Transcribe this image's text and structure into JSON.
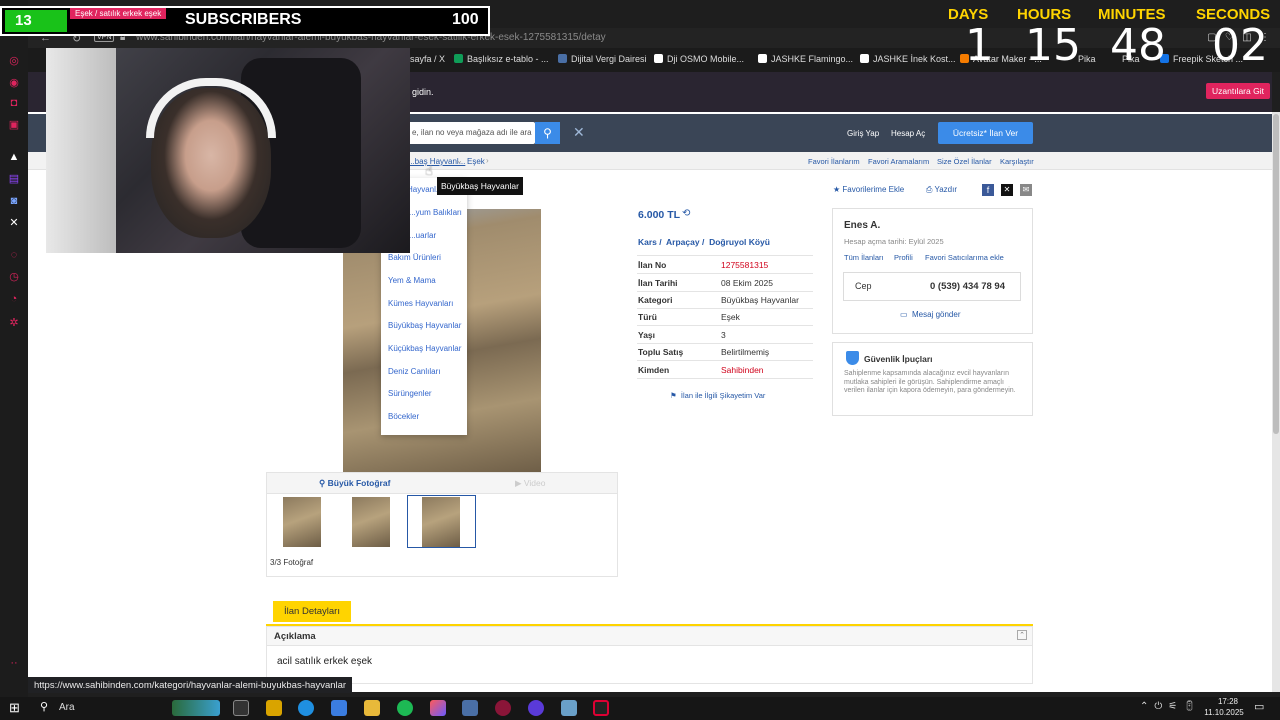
{
  "stream": {
    "sub_count_left": "13",
    "ticker_text": "Eşek / satılık erkek eşek",
    "subscribers_label": "SUBSCRIBERS",
    "subscribers_value": "100",
    "timer": {
      "days_label": "DAYS",
      "hours_label": "HOURS",
      "minutes_label": "MINUTES",
      "seconds_label": "SECONDS",
      "days": "1",
      "hours": "15",
      "minutes": "48",
      "seconds": "02"
    }
  },
  "browser": {
    "url": "www.sahibinden.com/ilan/hayvanlar-alemi-buyukbas-hayvanlar-esek-satilik-erkek-esek-1275581315/detay",
    "vpn_label": "VPN",
    "bookmarks": [
      "sayfa / X",
      "Başlıksız e-tablo - ...",
      "Dijital Vergi Dairesi",
      "Dji OSMO Mobile...",
      "JASHKE Flamingo...",
      "JASHKE İnek Kost...",
      "Avatar Maker - ...",
      "Pika",
      "Pika",
      "Freepik Sketch ..."
    ],
    "status_url": "https://www.sahibinden.com/kategori/hayvanlar-alemi-buyukbas-hayvanlar"
  },
  "site": {
    "infobar_text": "gidin.",
    "infobar_button": "Uzantılara Git",
    "search_placeholder": "e, ilan no veya mağaza adı ile ara",
    "login": "Giriş Yap",
    "register": "Hesap Aç",
    "post_ad": "Ücretsiz* İlan Ver",
    "breadcrumb": [
      "...baş Hayvanl...",
      "Eşek"
    ],
    "subnav": [
      "Favori İlanlarım",
      "Favori Aramalarım",
      "Size Özel İlanlar",
      "Karşılaştır"
    ],
    "tooltip": "Büyükbaş Hayvanlar",
    "dropdown": [
      "Hayvanl...",
      "...yum Balıkları",
      "...uarlar",
      "Bakım Ürünleri",
      "Yem & Mama",
      "Kümes Hayvanları",
      "Büyükbaş Hayvanlar",
      "Küçükbaş Hayvanlar",
      "Deniz Canlıları",
      "Sürüngenler",
      "Böcekler"
    ],
    "fav_add": "Favorilerime Ekle",
    "print": "Yazdır",
    "price": "6.000 TL",
    "location": [
      "Kars",
      "Arpaçay",
      "Doğruyol Köyü"
    ],
    "details": [
      {
        "k": "İlan No",
        "v": "1275581315"
      },
      {
        "k": "İlan Tarihi",
        "v": "08 Ekim 2025"
      },
      {
        "k": "Kategori",
        "v": "Büyükbaş Hayvanlar"
      },
      {
        "k": "Türü",
        "v": "Eşek"
      },
      {
        "k": "Yaşı",
        "v": "3"
      },
      {
        "k": "Toplu Satış",
        "v": "Belirtilmemiş"
      },
      {
        "k": "Kimden",
        "v": "Sahibinden"
      }
    ],
    "complaint": "İlan ile İlgili Şikayetim Var",
    "seller": {
      "name": "Enes A.",
      "since": "Hesap açma tarihi: Eylül 2025",
      "links": [
        "Tüm İlanları",
        "Profili",
        "Favori Satıcılarıma ekle"
      ],
      "phone_label": "Cep",
      "phone": "0 (539) 434 78 94",
      "message": "Mesaj gönder"
    },
    "security": {
      "title": "Güvenlik İpuçları",
      "text": "Sahiplenme kapsamında alacağınız evcil hayvanların mutlaka sahipleri ile görüşün. Sahiplendirme amaçlı verilen ilanlar için kapora ödemeyin, para göndermeyin."
    },
    "big_photo": "Büyük Fotoğraf",
    "video": "Video",
    "photo_count": "3/3 Fotoğraf",
    "tab_details": "İlan Detayları",
    "desc_title": "Açıklama",
    "desc_text": "acil satılık erkek eşek"
  },
  "taskbar": {
    "search": "Ara",
    "time": "17:28",
    "date": "11.10.2025"
  },
  "colors": {
    "accent_blue": "#3b8be8",
    "price_blue": "#2658a6",
    "red": "#d0021b",
    "yellow_tab": "#ffd400"
  }
}
